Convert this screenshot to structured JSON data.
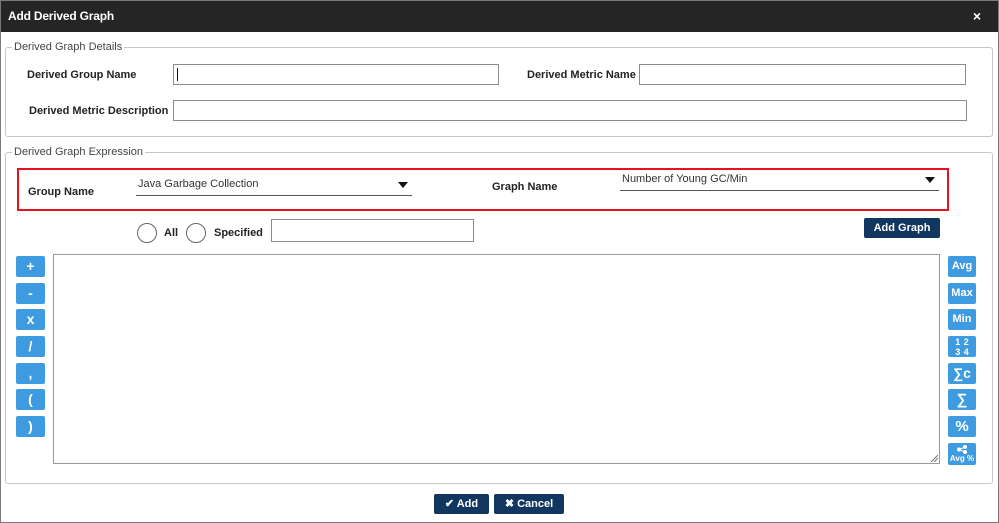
{
  "dialog": {
    "title": "Add Derived Graph",
    "close_icon": "×"
  },
  "details": {
    "legend": "Derived Graph Details",
    "group_name_label": "Derived Group Name",
    "group_name_value": "",
    "metric_name_label": "Derived Metric Name",
    "metric_name_value": "",
    "metric_description_label": "Derived Metric Description",
    "metric_description_value": ""
  },
  "expression": {
    "legend": "Derived Graph Expression",
    "group_name_label": "Group Name",
    "group_name_selected": "Java Garbage Collection",
    "graph_name_label": "Graph Name",
    "graph_name_selected": "Number of Young GC/Min",
    "radio_all_label": "All",
    "radio_specified_label": "Specified",
    "specified_value": "",
    "add_graph_label": "Add Graph",
    "expression_value": ""
  },
  "operators": [
    "+",
    "-",
    "x",
    "/",
    ",",
    "(",
    ")"
  ],
  "functions": [
    {
      "label": "Avg",
      "icon": "avg-icon"
    },
    {
      "label": "Max",
      "icon": "max-icon"
    },
    {
      "label": "Min",
      "icon": "min-icon"
    },
    {
      "label": "1 2 3 4",
      "icon": "fraction-icon"
    },
    {
      "label": "∑c",
      "icon": "sum-count-icon"
    },
    {
      "label": "∑",
      "icon": "sum-icon"
    },
    {
      "label": "%",
      "icon": "percent-icon"
    },
    {
      "label": "Avg %",
      "icon": "avg-percent-icon"
    }
  ],
  "footer": {
    "add_label": "Add",
    "cancel_label": "Cancel"
  },
  "colors": {
    "titlebar": "#252525",
    "navy_button": "#11365f",
    "operator_button": "#3f9be0",
    "highlight_border": "#e3141e"
  }
}
